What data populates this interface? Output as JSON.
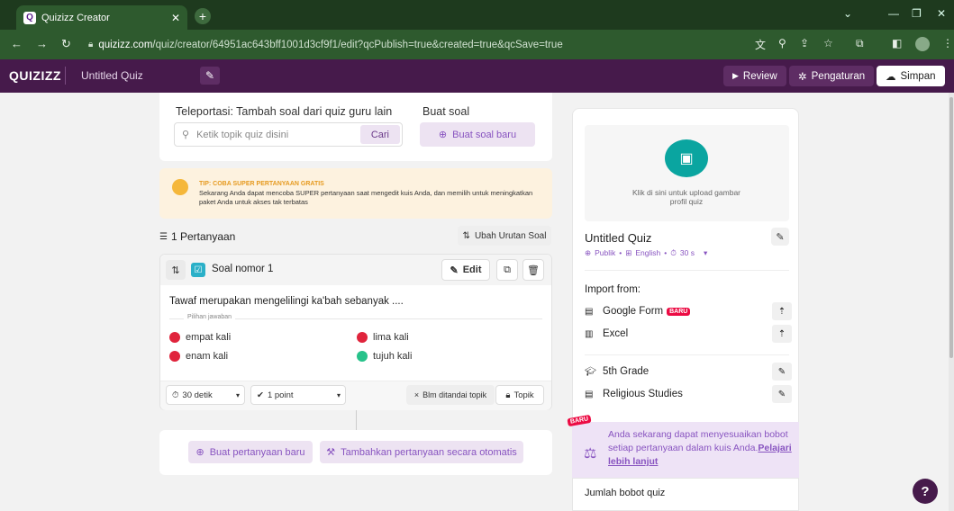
{
  "browser": {
    "tab_title": "Quizizz Creator",
    "url_host": "quizizz.com",
    "url_path": "/quiz/creator/64951ac643bff1001d3cf9f1/edit?qcPublish=true&created=true&qcSave=true"
  },
  "app": {
    "logo": "QUIZIZZ",
    "quiz_title": "Untitled Quiz",
    "review_label": "Review",
    "settings_label": "Pengaturan",
    "save_label": "Simpan"
  },
  "teleport": {
    "heading": "Teleportasi: Tambah soal dari quiz guru lain",
    "search_placeholder": "Ketik topik quiz disini",
    "search_button": "Cari",
    "create_heading": "Buat soal",
    "create_button": "Buat soal baru"
  },
  "tip": {
    "heading": "TIP: COBA SUPER PERTANYAAN GRATIS",
    "text": "Sekarang Anda dapat mencoba SUPER pertanyaan saat mengedit kuis Anda, dan memilih untuk meningkatkan paket Anda untuk akses tak terbatas"
  },
  "questions": {
    "count_label": "1 Pertanyaan",
    "reorder_label": "Ubah Urutan Soal"
  },
  "question": {
    "number_label": "Soal nomor 1",
    "edit_label": "Edit",
    "text": "Tawaf merupakan mengelilingi ka'bah sebanyak ....",
    "answers_label": "Pilihan jawaban",
    "answers": [
      {
        "text": "empat kali",
        "color": "#e0243c"
      },
      {
        "text": "lima kali",
        "color": "#e0243c"
      },
      {
        "text": "enam kali",
        "color": "#e0243c"
      },
      {
        "text": "tujuh kali",
        "color": "#27c28a"
      }
    ],
    "time_label": "30 detik",
    "points_label": "1 point",
    "topic_tag_label": "Blm ditandai topik",
    "topic_button": "Topik"
  },
  "bottom": {
    "new_question": "Buat pertanyaan baru",
    "auto_add": "Tambahkan pertanyaan secara otomatis"
  },
  "side": {
    "upload_text": "Klik di sini untuk upload gambar profil quiz",
    "quiz_title": "Untitled Quiz",
    "meta_public": "Publik",
    "meta_lang": "English",
    "meta_time": "30 s",
    "import_heading": "Import from:",
    "google_form": "Google Form",
    "google_form_badge": "BARU",
    "excel": "Excel",
    "grade": "5th Grade",
    "subject": "Religious Studies",
    "weight_badge": "BARU",
    "weight_text": "Anda sekarang dapat menyesuaikan bobot setiap pertanyaan dalam kuis Anda.",
    "weight_link": "Pelajari lebih lanjut",
    "weight_total": "Jumlah bobot quiz",
    "help": "?"
  }
}
